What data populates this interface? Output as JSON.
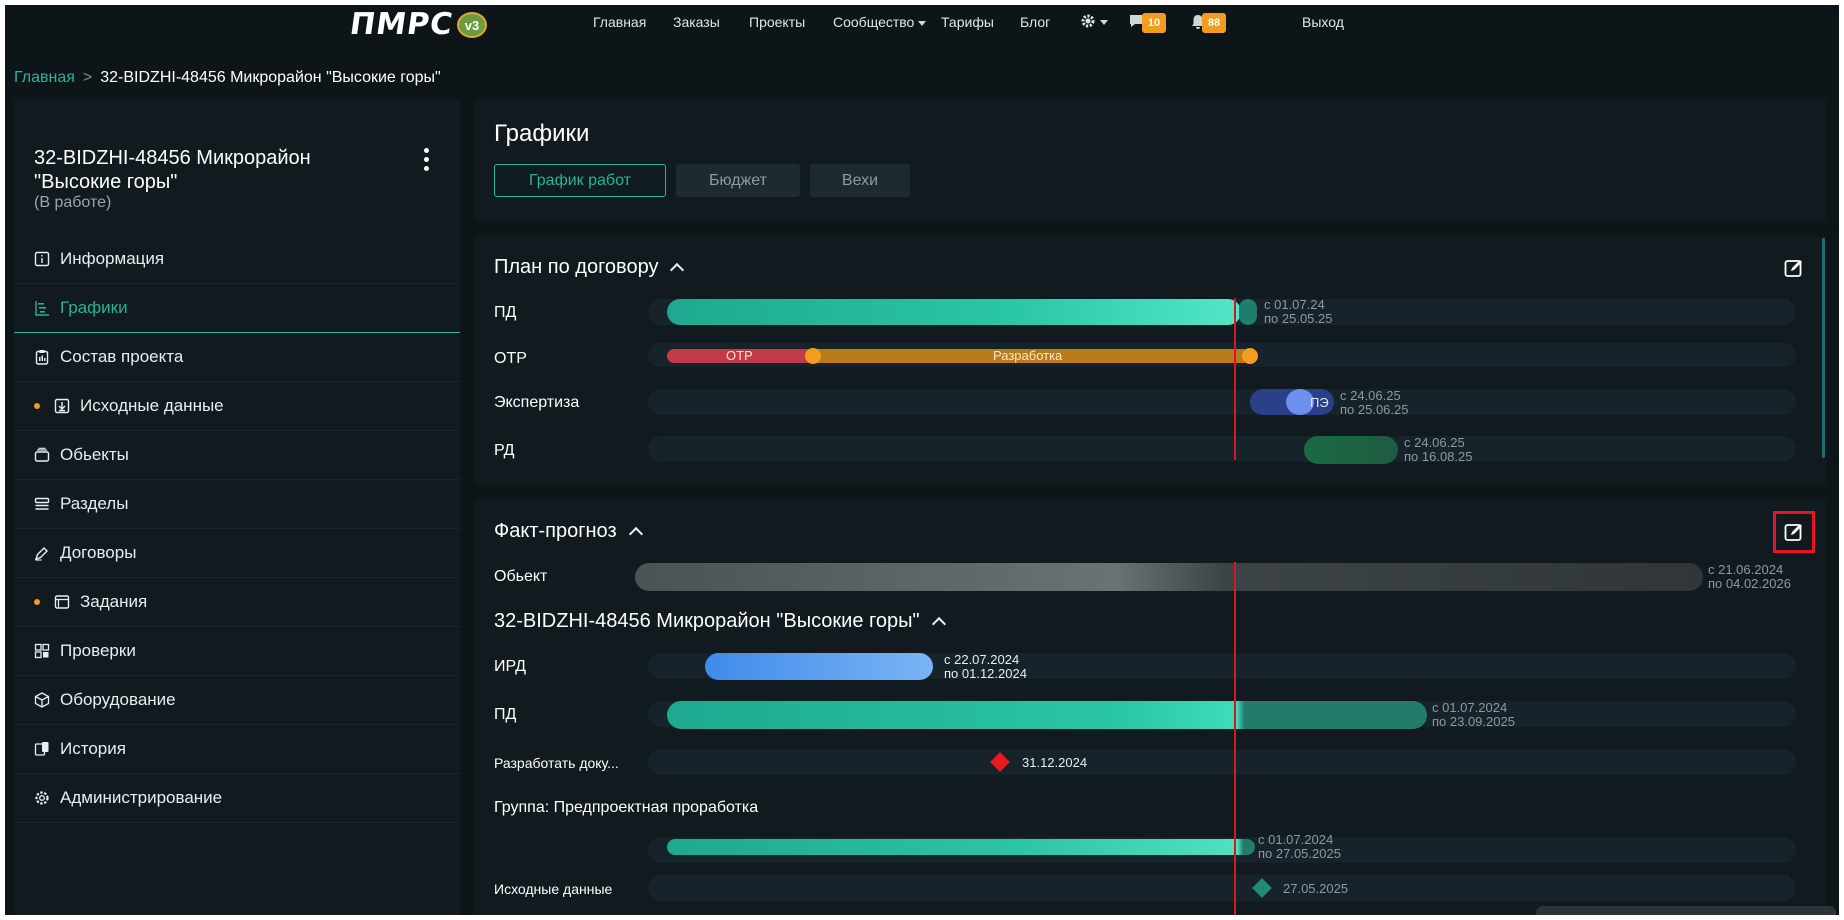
{
  "nav": {
    "logo_text": "ПМРС",
    "logo_version": "v3",
    "items": [
      "Главная",
      "Заказы",
      "Проекты",
      "Сообщество",
      "Тарифы",
      "Блог"
    ],
    "messages_count": "10",
    "notifications_count": "88",
    "logout": "Выход"
  },
  "breadcrumb": {
    "home": "Главная",
    "separator": ">",
    "current": "32-BIDZHI-48456 Микрорайон \"Высокие горы\""
  },
  "sidebar": {
    "project_title": "32-BIDZHI-48456 Микрорайон \"Высокие горы\"",
    "project_status": "(В работе)",
    "items": [
      {
        "label": "Информация",
        "icon": "info-icon"
      },
      {
        "label": "Графики",
        "icon": "gantt-icon"
      },
      {
        "label": "Состав проекта",
        "icon": "clipboard-icon"
      },
      {
        "label": "Исходные данные",
        "icon": "download-box-icon"
      },
      {
        "label": "Обьекты",
        "icon": "layers-icon"
      },
      {
        "label": "Разделы",
        "icon": "sections-icon"
      },
      {
        "label": "Договоры",
        "icon": "pen-icon"
      },
      {
        "label": "Задания",
        "icon": "window-icon"
      },
      {
        "label": "Проверки",
        "icon": "grid-icon"
      },
      {
        "label": "Оборудование",
        "icon": "cube-icon"
      },
      {
        "label": "История",
        "icon": "history-icon"
      },
      {
        "label": "Администрирование",
        "icon": "gear-icon"
      }
    ]
  },
  "charts_panel": {
    "title": "Графики",
    "tabs": [
      "График работ",
      "Бюджет",
      "Вехи"
    ]
  },
  "plan": {
    "title": "План по договору",
    "rows": [
      {
        "label": "ПД",
        "dates": [
          "с 01.07.24",
          "по 25.05.25"
        ]
      },
      {
        "label": "ОТР",
        "segments": [
          "ОТР",
          "Разработка"
        ]
      },
      {
        "label": "Экспертиза",
        "inbar": "ПЭ",
        "dates": [
          "с 24.06.25",
          "по 25.06.25"
        ]
      },
      {
        "label": "РД",
        "dates": [
          "с 24.06.25",
          "по 16.08.25"
        ]
      }
    ]
  },
  "fact": {
    "title": "Факт-прогноз",
    "object_label": "Обьект",
    "object_dates": [
      "с 21.06.2024",
      "по 04.02.2026"
    ],
    "project_title": "32-BIDZHI-48456 Микрорайон \"Высокие горы\"",
    "rows": [
      {
        "label": "ИРД",
        "dates": [
          "с 22.07.2024",
          "по 01.12.2024"
        ]
      },
      {
        "label": "ПД",
        "dates": [
          "с 01.07.2024",
          "по 23.09.2025"
        ]
      },
      {
        "label": "Разработать доку...",
        "milestone": "31.12.2024"
      }
    ],
    "group_label": "Группа: Предпроектная проработка",
    "group_dates": [
      "с 01.07.2024",
      "по 27.05.2025"
    ],
    "source_label": "Исходные данные",
    "source_milestone": "27.05.2025"
  },
  "colors": {
    "accent": "#25b39a",
    "today_line": "#d4172b",
    "badge": "#f39c1f"
  }
}
